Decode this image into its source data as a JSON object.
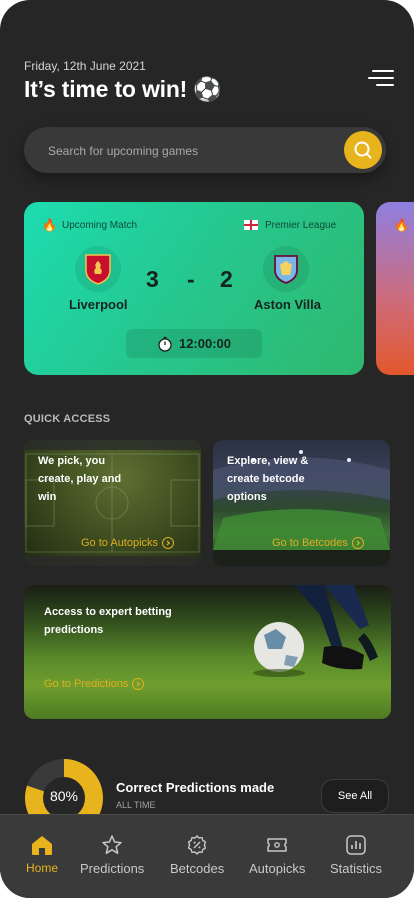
{
  "header": {
    "date": "Friday, 12th June 2021",
    "title": "It’s time to win! ⚽",
    "menu_icon": "hamburger-menu-icon"
  },
  "search": {
    "placeholder": "Search for upcoming games",
    "icon": "search-icon"
  },
  "match": {
    "status_label": "Upcoming Match",
    "league": "Premier League",
    "home_team": "Liverpool",
    "away_team": "Aston Villa",
    "home_score": "3",
    "separator": "-",
    "away_score": "2",
    "time": "12:00:00"
  },
  "quick_access": {
    "title": "QUICK ACCESS",
    "tiles": [
      {
        "text": "We pick, you create, play and win",
        "link": "Go to Autopicks"
      },
      {
        "text": "Explore, view & create betcode options",
        "link": "Go to Betcodes"
      },
      {
        "text": "Access to expert betting predictions",
        "link": "Go to Predictions"
      }
    ]
  },
  "stats": {
    "percent": "80%",
    "percent_value": 0.8,
    "title": "Correct Predictions made",
    "subtitle": "ALL TIME",
    "see_all": "See All"
  },
  "tabs": [
    {
      "label": "Home",
      "icon": "home-icon",
      "active": true
    },
    {
      "label": "Predictions",
      "icon": "star-icon",
      "active": false
    },
    {
      "label": "Betcodes",
      "icon": "betcode-icon",
      "active": false
    },
    {
      "label": "Autopicks",
      "icon": "ticket-icon",
      "active": false
    },
    {
      "label": "Statistics",
      "icon": "statistics-icon",
      "active": false
    }
  ],
  "colors": {
    "accent": "#e8b41d",
    "background": "#262626",
    "card_green": "#25c890",
    "tabbar": "#3a3a3a"
  }
}
